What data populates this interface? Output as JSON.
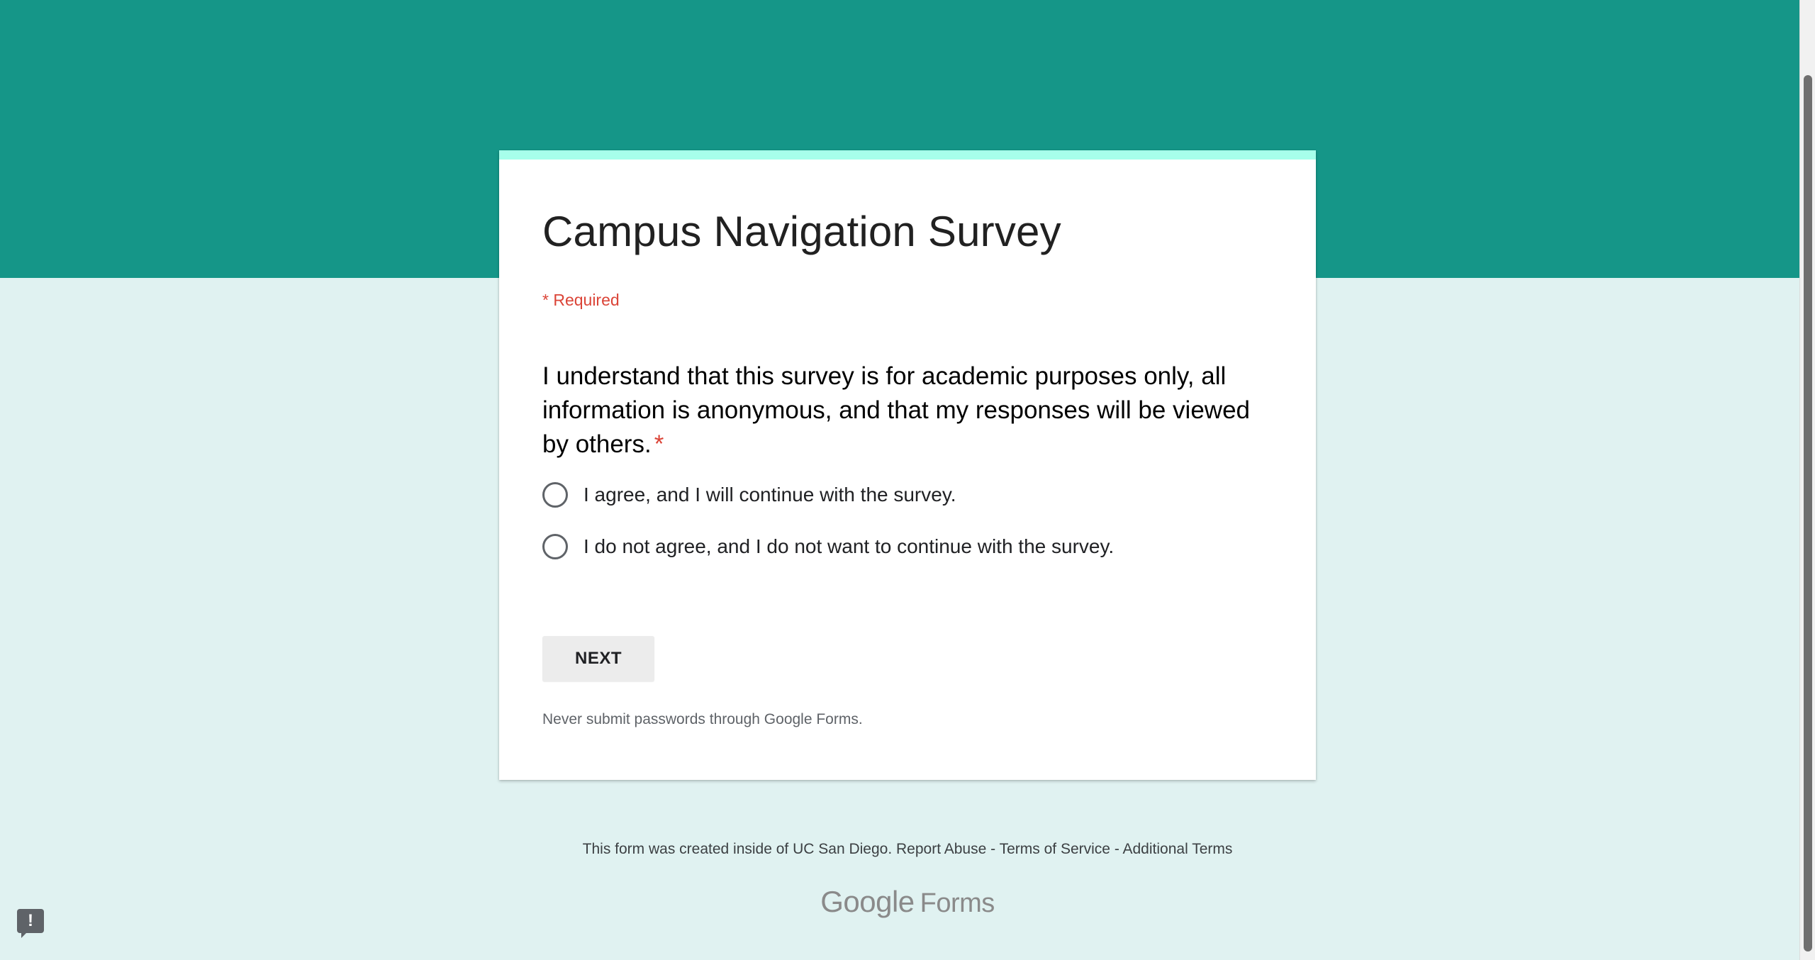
{
  "form": {
    "title": "Campus Navigation Survey",
    "required_note": "* Required",
    "question": {
      "text": "I understand that this survey is for academic purposes only, all information is anonymous, and that my responses will be viewed by others.",
      "required_marker": "*",
      "options": [
        {
          "label": "I agree, and I will continue with the survey.",
          "selected": false
        },
        {
          "label": "I do not agree, and I do not want to continue with the survey.",
          "selected": false
        }
      ]
    },
    "next_label": "NEXT",
    "password_note": "Never submit passwords through Google Forms."
  },
  "footer": {
    "created_text": "This form was created inside of UC San Diego.",
    "report_abuse": "Report Abuse",
    "separator": "-",
    "terms": "Terms of Service",
    "additional_terms": "Additional Terms"
  },
  "brand": {
    "google": "Google",
    "forms": "Forms"
  },
  "feedback": {
    "icon": "feedback-exclamation-icon",
    "glyph": "!"
  },
  "colors": {
    "header_teal": "#159688",
    "page_background": "#e0f2f1",
    "accent_strip": "#a7ffeb",
    "required_red": "#db4437"
  }
}
